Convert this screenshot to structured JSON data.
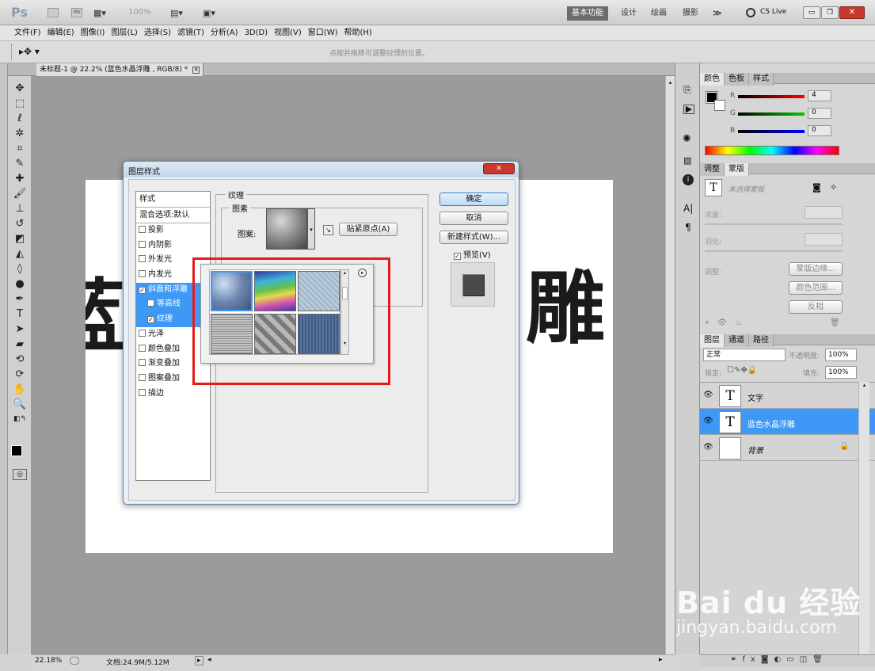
{
  "app": {
    "logo": "Ps",
    "zoom": "100%",
    "workspaces": [
      "基本功能",
      "设计",
      "绘画",
      "摄影"
    ],
    "more": "≫",
    "cslive": "CS Live"
  },
  "menu": [
    "文件(F)",
    "编辑(E)",
    "图像(I)",
    "图层(L)",
    "选择(S)",
    "滤镜(T)",
    "分析(A)",
    "3D(D)",
    "视图(V)",
    "窗口(W)",
    "帮助(H)"
  ],
  "options": {
    "hint": "点按并拖移可调整纹理的位置。"
  },
  "document": {
    "tab_title": "未标题-1 @ 22.2% (蓝色水晶浮雕 , RGB/8) *",
    "char_left": "蓝",
    "char_right": "雕"
  },
  "status": {
    "zoom": "22.18%",
    "doc_info": "文档:24.9M/5.12M"
  },
  "dialog": {
    "title": "图层样式",
    "styles_header": "样式",
    "blend_options": "混合选项:默认",
    "items": [
      {
        "label": "投影",
        "checked": false
      },
      {
        "label": "内阴影",
        "checked": false
      },
      {
        "label": "外发光",
        "checked": false
      },
      {
        "label": "内发光",
        "checked": false
      },
      {
        "label": "斜面和浮雕",
        "checked": true
      },
      {
        "label": "等高线",
        "checked": false
      },
      {
        "label": "纹理",
        "checked": true
      },
      {
        "label": "光泽",
        "checked": false
      },
      {
        "label": "颜色叠加",
        "checked": false
      },
      {
        "label": "渐变叠加",
        "checked": false
      },
      {
        "label": "图案叠加",
        "checked": false
      },
      {
        "label": "描边",
        "checked": false
      }
    ],
    "section_title": "纹理",
    "subsection_title": "图素",
    "pattern_label": "图案:",
    "snap_button": "贴紧原点(A)",
    "ok_button": "确定",
    "cancel_button": "取消",
    "new_style_button": "新建样式(W)...",
    "preview_label": "预览(V)",
    "close_label": "✕"
  },
  "color_panel": {
    "tabs": [
      "颜色",
      "色板",
      "样式"
    ],
    "r_label": "R",
    "g_label": "G",
    "b_label": "B",
    "r_value": "4",
    "g_value": "0",
    "b_value": "0"
  },
  "adjust_panel": {
    "tabs": [
      "调整",
      "蒙版"
    ],
    "no_mask": "未选择蒙版",
    "density_label": "浓度:",
    "feather_label": "羽化:",
    "refine_label": "调整:",
    "btn_mask_edge": "蒙版边缘...",
    "btn_color_range": "颜色范围...",
    "btn_invert": "反相"
  },
  "layers_panel": {
    "tabs": [
      "图层",
      "通道",
      "路径"
    ],
    "blend_mode": "正常",
    "opacity_label": "不透明度:",
    "opacity_value": "100%",
    "lock_label": "锁定:",
    "fill_label": "填充:",
    "fill_value": "100%",
    "layers": [
      {
        "name": "文字",
        "thumb": "T",
        "selected": false
      },
      {
        "name": "蓝色水晶浮雕",
        "thumb": "T",
        "selected": true
      },
      {
        "name": "背景",
        "thumb": "",
        "selected": false
      }
    ]
  },
  "watermark": {
    "brand": "Bai du 经验",
    "url": "jingyan.baidu.com"
  },
  "colors": {
    "accent": "#3d99f5",
    "highlight": "#e51a1a",
    "titlebar_close": "#c8382d"
  }
}
